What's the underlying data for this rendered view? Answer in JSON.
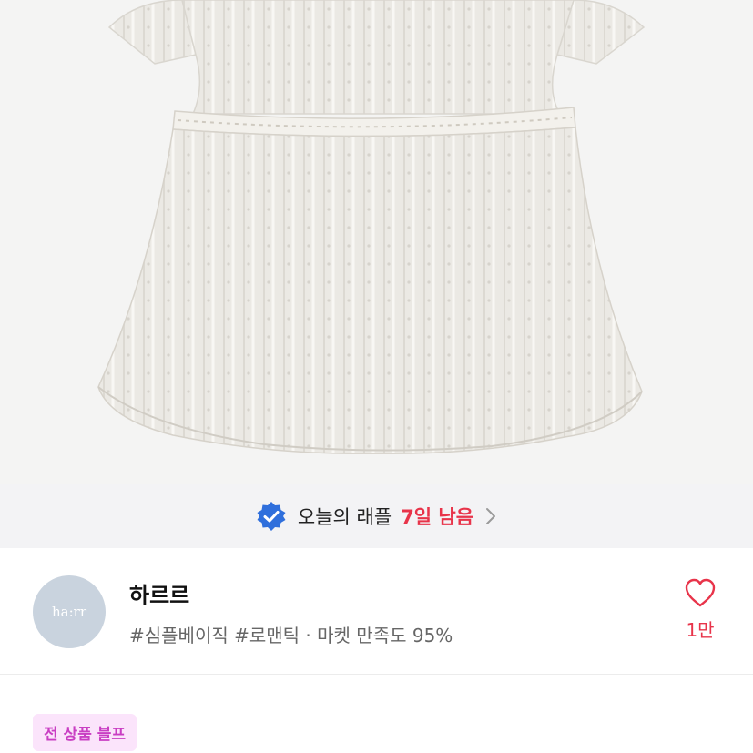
{
  "product_image": {
    "logo_text": ""
  },
  "raffle": {
    "title": "오늘의 래플",
    "remaining": "7일 남음",
    "badge_icon": "verified-badge-icon",
    "accent_color": "#e8344a",
    "badge_color": "#2f6fdc"
  },
  "shop": {
    "avatar_text": "ha:rr",
    "name": "하르르",
    "meta": "#심플베이직 #로맨틱 · 마켓 만족도 95%",
    "like_count": "1만",
    "like_icon": "heart-outline-icon"
  },
  "promo_badge": "전 상품 블프"
}
